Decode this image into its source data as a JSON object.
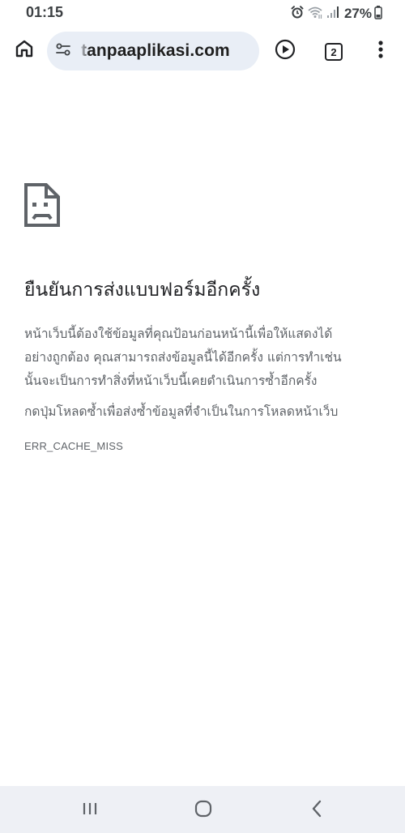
{
  "status_bar": {
    "time": "01:15",
    "battery_percent": "27%",
    "icons": [
      "alarm-icon",
      "wifi-icon",
      "signal-icon",
      "battery-icon"
    ]
  },
  "toolbar": {
    "url": "tanpaaplikasi.com",
    "tab_count": "2",
    "icons": [
      "home-icon",
      "site-info-icon",
      "play-icon",
      "tab-switcher-icon",
      "more-vert-icon"
    ]
  },
  "error": {
    "icon": "sad-page-icon",
    "title": "ยืนยันการส่งแบบฟอร์มอีกครั้ง",
    "paragraph_lines": [
      "หน้าเว็บนี้ต้องใช้ข้อมูลที่คุณป้อนก่อนหน้านี้เพื่อให้แสดงได้",
      "อย่างถูกต้อง คุณสามารถส่งข้อมูลนี้ได้อีกครั้ง แต่การทำเช่น",
      "นั้นจะเป็นการทำสิ่งที่หน้าเว็บนี้เคยดำเนินการซ้ำอีกครั้ง"
    ],
    "instruction": "กดปุ่มโหลดซ้ำเพื่อส่งซ้ำข้อมูลที่จำเป็นในการโหลดหน้าเว็บ",
    "code": "ERR_CACHE_MISS"
  },
  "nav_bar": {
    "icons": [
      "recents-icon",
      "home-circle-icon",
      "back-icon"
    ]
  },
  "colors": {
    "omnibox_bg": "#e9eef6",
    "text_primary": "#202124",
    "text_secondary": "#5f6368",
    "nav_bar_bg": "#eef0f5"
  }
}
